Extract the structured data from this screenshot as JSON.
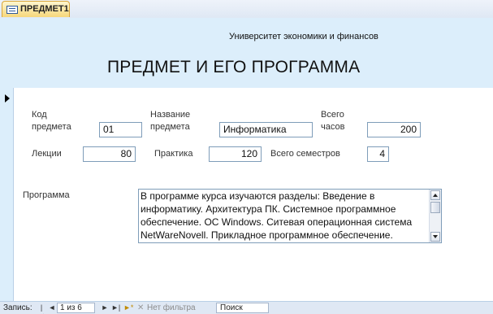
{
  "tab": {
    "label": "ПРЕДМЕТ1"
  },
  "header": {
    "organization": "Университет экономики и финансов",
    "title": "ПРЕДМЕТ И ЕГО ПРОГРАММА"
  },
  "fields": {
    "code_label": "Код\nпредмета",
    "code_value": "01",
    "name_label": "Название\nпредмета",
    "name_value": "Информатика",
    "total_hours_label": "Всего\nчасов",
    "total_hours_value": "200",
    "lectures_label": "Лекции",
    "lectures_value": "80",
    "practice_label": "Практика",
    "practice_value": "120",
    "semesters_label": "Всего семестров",
    "semesters_value": "4",
    "program_label": "Программа",
    "program_text": "В  программе курса изучаются разделы: Введение в информатику. Архитектура ПК. Системное программное обеспечение. ОС Windows.  Ситевая операционная система NetWareNovell. Прикладное программное обеспечение."
  },
  "navigation": {
    "record_label": "Запись:",
    "position": "1 из 6",
    "filter_label": "Нет фильтра",
    "search_placeholder": "Поиск"
  },
  "icons": {
    "first": "first-record-icon",
    "prev": "prev-record-icon",
    "next": "next-record-icon",
    "last": "last-record-icon",
    "new": "new-record-icon",
    "filter": "filter-icon",
    "form": "form-icon"
  }
}
